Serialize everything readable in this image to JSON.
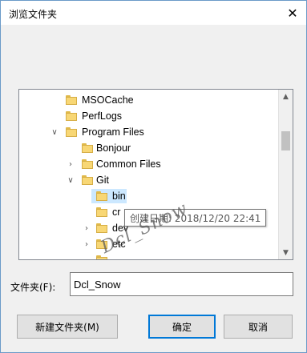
{
  "window": {
    "title": "浏览文件夹",
    "close_glyph": "✕"
  },
  "tree": {
    "items": [
      {
        "label": "MSOCache",
        "expander": ""
      },
      {
        "label": "PerfLogs",
        "expander": ""
      },
      {
        "label": "Program Files",
        "expander": "∨"
      },
      {
        "label": "Bonjour",
        "expander": ""
      },
      {
        "label": "Common Files",
        "expander": "›"
      },
      {
        "label": "Git",
        "expander": "∨"
      },
      {
        "label": "bin",
        "expander": ""
      },
      {
        "label": "cr",
        "expander": ""
      },
      {
        "label": "dev",
        "expander": "›"
      },
      {
        "label": "etc",
        "expander": "›"
      },
      {
        "label": "",
        "expander": ""
      }
    ],
    "scroll_up_glyph": "▲",
    "scroll_down_glyph": "▼"
  },
  "tooltip": {
    "text": "创建日期: 2018/12/20 22:41"
  },
  "watermark": {
    "text": "Dcl_Snow"
  },
  "folder_field": {
    "label": "文件夹(F):",
    "value": "Dcl_Snow"
  },
  "buttons": {
    "new_folder": "新建文件夹(M)",
    "ok": "确定",
    "cancel": "取消"
  },
  "colors": {
    "accent": "#0078d7",
    "selection": "#cce8ff",
    "folder": "#f8d775"
  }
}
